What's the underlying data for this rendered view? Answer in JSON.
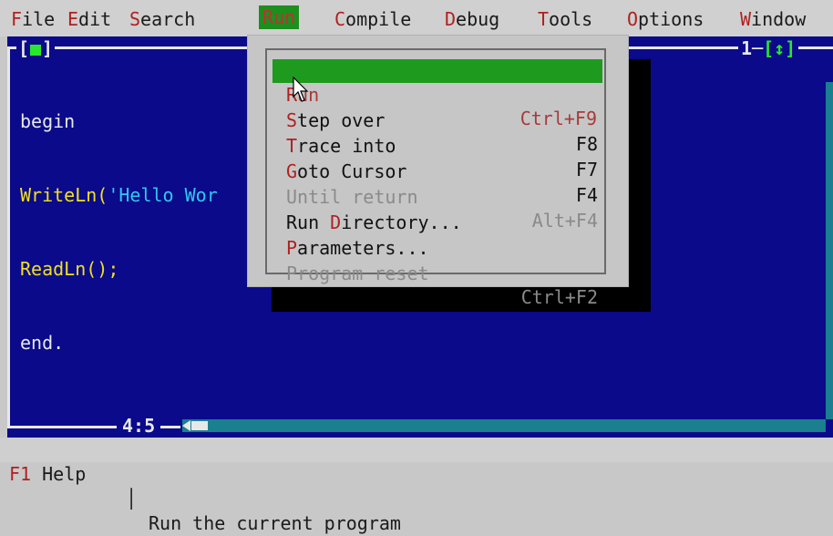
{
  "menubar": {
    "items": [
      {
        "hot": "F",
        "rest": "ile"
      },
      {
        "hot": "E",
        "rest": "dit"
      },
      {
        "hot": "S",
        "rest": "earch"
      },
      {
        "hot": "R",
        "rest": "un"
      },
      {
        "hot": "C",
        "rest": "ompile"
      },
      {
        "hot": "D",
        "rest": "ebug"
      },
      {
        "hot": "T",
        "rest": "ools"
      },
      {
        "hot": "O",
        "rest": "ptions"
      },
      {
        "hot": "W",
        "rest": "indow"
      }
    ],
    "active": "Run"
  },
  "editor": {
    "close_box": "[■]",
    "window_number": "1",
    "zoom_box": "[↕]",
    "cursor_position": "4:5",
    "code_lines": [
      {
        "parts": [
          {
            "t": "begin",
            "c": "kw"
          }
        ]
      },
      {
        "parts": [
          {
            "t": "WriteLn(",
            "c": "ident"
          },
          {
            "t": "'Hello Wor",
            "c": "str"
          }
        ]
      },
      {
        "parts": [
          {
            "t": "ReadLn();",
            "c": "ident"
          }
        ]
      },
      {
        "parts": [
          {
            "t": "end.",
            "c": "kw"
          }
        ]
      }
    ]
  },
  "run_menu": {
    "items": [
      {
        "pre": "",
        "hot": "R",
        "post": "un",
        "shortcut": "Ctrl+F9",
        "state": "selected"
      },
      {
        "pre": "",
        "hot": "S",
        "post": "tep over",
        "shortcut": "F8",
        "state": "normal"
      },
      {
        "pre": "",
        "hot": "T",
        "post": "race into",
        "shortcut": "F7",
        "state": "normal"
      },
      {
        "pre": "",
        "hot": "G",
        "post": "oto Cursor",
        "shortcut": "F4",
        "state": "normal"
      },
      {
        "pre": "",
        "hot": "",
        "post": "Until return",
        "shortcut": "Alt+F4",
        "state": "disabled"
      },
      {
        "pre": "Run ",
        "hot": "D",
        "post": "irectory...",
        "shortcut": "",
        "state": "normal"
      },
      {
        "pre": "",
        "hot": "P",
        "post": "arameters...",
        "shortcut": "",
        "state": "normal"
      },
      {
        "pre": "",
        "hot": "",
        "post": "Program reset",
        "shortcut": "Ctrl+F2",
        "state": "disabled"
      }
    ]
  },
  "statusbar": {
    "f1_key": "F1",
    "f1_label": " Help",
    "separator": "│",
    "message": "Run the current program"
  },
  "colors": {
    "editor_background": "#0a0a8a",
    "menu_selection": "#1e9a1e",
    "hotkey": "#b02020",
    "keyword": "#e8e8e8",
    "identifier": "#f0e020",
    "string": "#30c8f0"
  }
}
